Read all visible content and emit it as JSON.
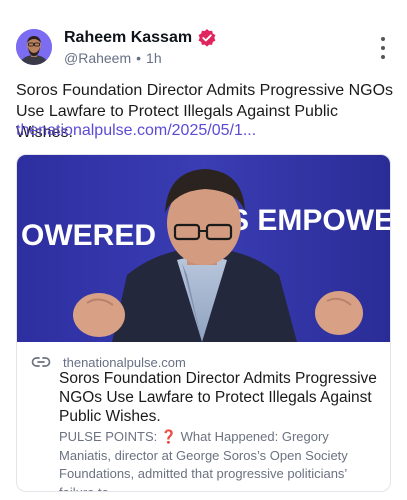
{
  "post": {
    "author_name": "Raheem Kassam",
    "handle": "@Raheem",
    "separator": "•",
    "time": "1h",
    "text": "Soros Foundation Director Admits Progressive NGOs Use Lawfare to Protect Illegals Against Public Wishes.",
    "link_text": "thenationalpulse.com/2025/05/1..."
  },
  "card": {
    "image_banner_left": "OWERED",
    "image_banner_right": "S EMPOWERED",
    "domain": "thenationalpulse.com",
    "title": "Soros Foundation Director Admits Progressive NGOs Use Lawfare to Protect Illegals Against Public Wishes.",
    "description": "PULSE POINTS: ❓ What Happened: Gregory Maniatis, director at George Soros’s Open Society Foundations, admitted that progressive politicians’ failure to"
  },
  "colors": {
    "accent": "#5b4bd6",
    "verified_badge": "#e0245e",
    "banner_blue": "#2b2f9e"
  },
  "icons": {
    "verified": "verified-badge-icon",
    "more": "more-vertical-icon",
    "link": "chain-link-icon"
  }
}
